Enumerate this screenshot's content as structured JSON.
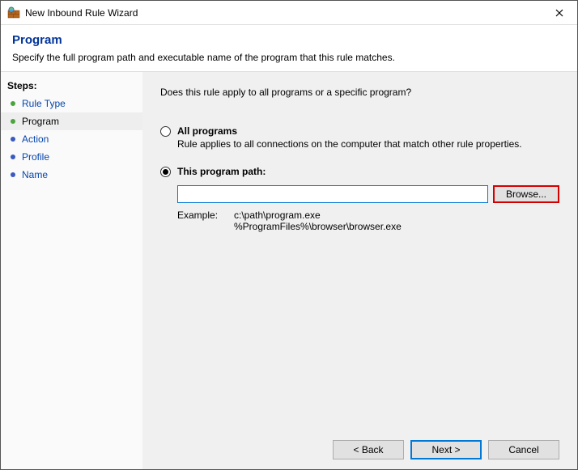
{
  "window": {
    "title": "New Inbound Rule Wizard"
  },
  "header": {
    "title": "Program",
    "description": "Specify the full program path and executable name of the program that this rule matches."
  },
  "sidebar": {
    "title": "Steps:",
    "items": [
      {
        "label": "Rule Type",
        "active": false,
        "done": true
      },
      {
        "label": "Program",
        "active": true,
        "done": false
      },
      {
        "label": "Action",
        "active": false,
        "done": false
      },
      {
        "label": "Profile",
        "active": false,
        "done": false
      },
      {
        "label": "Name",
        "active": false,
        "done": false
      }
    ]
  },
  "content": {
    "question": "Does this rule apply to all programs or a specific program?",
    "option_all": {
      "label": "All programs",
      "sub": "Rule applies to all connections on the computer that match other rule properties.",
      "selected": false
    },
    "option_path": {
      "label": "This program path:",
      "selected": true,
      "input_value": "",
      "browse_label": "Browse..."
    },
    "example": {
      "label": "Example:",
      "line1": "c:\\path\\program.exe",
      "line2": "%ProgramFiles%\\browser\\browser.exe"
    }
  },
  "footer": {
    "back": "< Back",
    "next": "Next >",
    "cancel": "Cancel"
  }
}
